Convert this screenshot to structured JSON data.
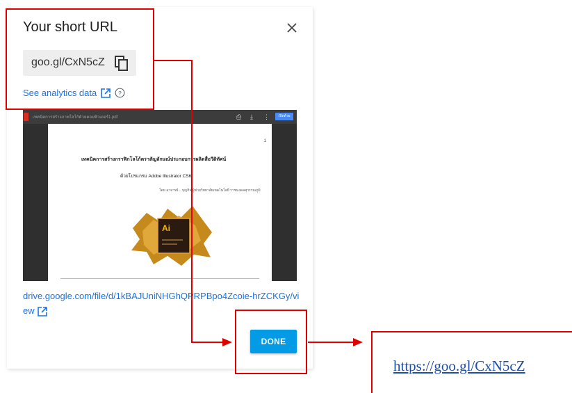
{
  "dialog": {
    "title": "Your short URL",
    "short_url": "goo.gl/CxN5cZ",
    "analytics_label": "See analytics data",
    "preview": {
      "filename": "เทคนิคการสร้างภาพโลโก้ด้วยคอมพิวเตอร์1.pdf",
      "open_button": "เปิดด้วย",
      "page_number": "1",
      "heading_line1": "เทคนิคการสร้างกราฟิกโลโก้ตราสัญลักษณ์ประกอบการผลิตสื่อวีดิทัศน์",
      "heading_line2": "ด้วยโปรแกรม Adobe Illustrator CS6",
      "author_line": "โดย อาจารย์... บุญกิจ ผู้ช่วยวิทยาลัยเทคโนโลยี ราชมงคลสุวรรณภูมิ",
      "product_badge": "Ai"
    },
    "drive_link": "drive.google.com/file/d/1kBAJUniNHGhQPRPBpo4Zcoie-hrZCKGy/view",
    "done_label": "DONE"
  },
  "annotation": {
    "result_url": "https://goo.gl/CxN5cZ",
    "color": "#e00000"
  },
  "colors": {
    "link": "#1a73e8",
    "done_button": "#039be5",
    "chip": "#eeeeee"
  }
}
